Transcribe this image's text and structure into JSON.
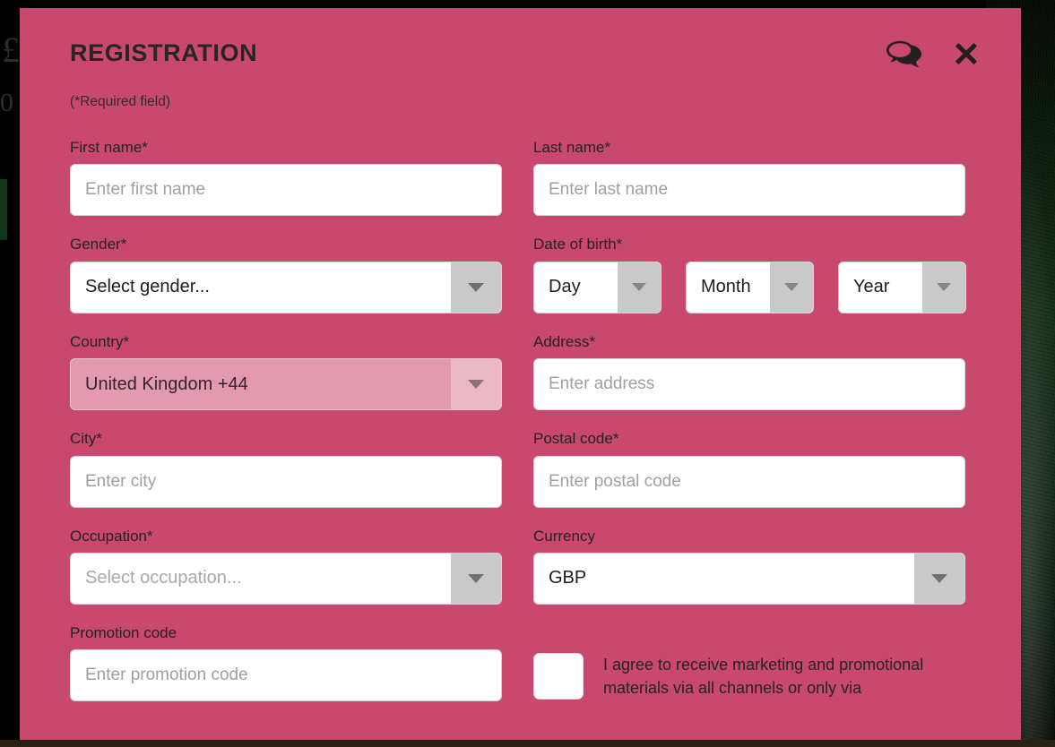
{
  "background": {
    "currency_symbol": "£",
    "amount": "0"
  },
  "modal": {
    "title": "REGISTRATION",
    "subtitle": "(*Required field)",
    "icons": {
      "chat": "chat-bubbles-icon",
      "close": "close-x-icon"
    },
    "accent_color": "#c9486d",
    "fields": {
      "first_name": {
        "label": "First name*",
        "value": "",
        "placeholder": "Enter first name"
      },
      "last_name": {
        "label": "Last name*",
        "value": "",
        "placeholder": "Enter last name"
      },
      "gender": {
        "label": "Gender*",
        "value": "Select gender...",
        "is_placeholder": true
      },
      "date_of_birth": {
        "label": "Date of birth*",
        "day": "Day",
        "month": "Month",
        "year": "Year"
      },
      "country": {
        "label": "Country*",
        "value": "United Kingdom +44",
        "disabled": true
      },
      "address": {
        "label": "Address*",
        "value": "",
        "placeholder": "Enter address"
      },
      "city": {
        "label": "City*",
        "value": "",
        "placeholder": "Enter city"
      },
      "postal_code": {
        "label": "Postal code*",
        "value": "",
        "placeholder": "Enter postal code"
      },
      "occupation": {
        "label": "Occupation*",
        "value": "Select occupation...",
        "is_placeholder": true
      },
      "currency": {
        "label": "Currency",
        "value": "GBP",
        "is_placeholder": false
      },
      "promotion_code": {
        "label": "Promotion code",
        "value": "",
        "placeholder": "Enter promotion code"
      },
      "marketing_consent": {
        "checked": false,
        "text": "I agree to receive marketing and promotional materials via all channels or only via"
      }
    }
  }
}
